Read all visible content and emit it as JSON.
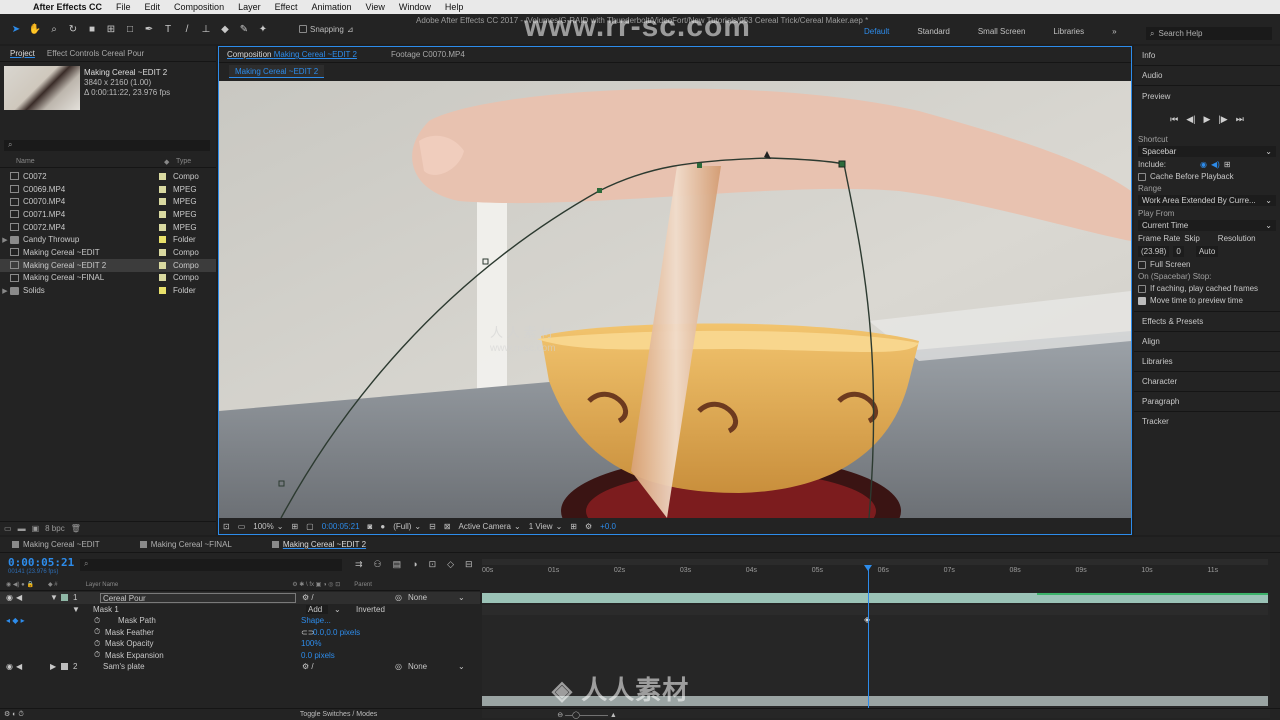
{
  "menubar": {
    "app": "After Effects CC",
    "items": [
      "File",
      "Edit",
      "Composition",
      "Layer",
      "Effect",
      "Animation",
      "View",
      "Window",
      "Help"
    ]
  },
  "toolbar": {
    "window_title": "Adobe After Effects CC 2017 - /Volumes/G-RAID with Thunderbolt/VideoFort/New Tutorials/053 Cereal Trick/Cereal Maker.aep *",
    "snapping_label": "Snapping",
    "workspaces": [
      "Default",
      "Standard",
      "Small Screen",
      "Libraries"
    ],
    "search_placeholder": "Search Help"
  },
  "watermark": {
    "url": "www.rr-sc.com",
    "small": "人 人 素 材",
    "small_url": "www.rr-sc.com",
    "logo": "人人素材"
  },
  "project": {
    "tab_project": "Project",
    "tab_effects": "Effect Controls Cereal Pour",
    "selected_name": "Making Cereal ~EDIT 2",
    "selected_dims": "3840 x 2160 (1.00)",
    "selected_duration": "Δ 0:00:11:22, 23.976 fps",
    "col_name": "Name",
    "col_type": "Type",
    "items": [
      {
        "name": "C0072",
        "type": "Compo",
        "kind": "comp",
        "label": "#d9d9a0"
      },
      {
        "name": "C0069.MP4",
        "type": "MPEG",
        "kind": "file",
        "label": "#d9d9a0"
      },
      {
        "name": "C0070.MP4",
        "type": "MPEG",
        "kind": "file",
        "label": "#d9d9a0"
      },
      {
        "name": "C0071.MP4",
        "type": "MPEG",
        "kind": "file",
        "label": "#d9d9a0"
      },
      {
        "name": "C0072.MP4",
        "type": "MPEG",
        "kind": "file",
        "label": "#d9d9a0"
      },
      {
        "name": "Candy Throwup",
        "type": "Folder",
        "kind": "folder",
        "label": "#e8e06a"
      },
      {
        "name": "Making Cereal ~EDIT",
        "type": "Compo",
        "kind": "comp",
        "label": "#d9d9a0"
      },
      {
        "name": "Making Cereal ~EDIT 2",
        "type": "Compo",
        "kind": "comp",
        "label": "#d9d9a0"
      },
      {
        "name": "Making Cereal ~FINAL",
        "type": "Compo",
        "kind": "comp",
        "label": "#d9d9a0"
      },
      {
        "name": "Solids",
        "type": "Folder",
        "kind": "folder",
        "label": "#e8e06a"
      }
    ],
    "bpc": "8 bpc"
  },
  "composition": {
    "tab_prefix": "Composition",
    "tab_name": "Making Cereal ~EDIT 2",
    "tab_footage": "Footage C0070.MP4",
    "breadcrumb": "Making Cereal ~EDIT 2",
    "zoom": "100%",
    "time": "0:00:05:21",
    "resolution": "(Full)",
    "camera": "Active Camera",
    "views": "1 View",
    "exposure": "+0.0"
  },
  "right_panels": {
    "info": "Info",
    "audio": "Audio",
    "preview": "Preview",
    "shortcut_label": "Shortcut",
    "shortcut_value": "Spacebar",
    "include_label": "Include:",
    "cache_before": "Cache Before Playback",
    "range_label": "Range",
    "range_value": "Work Area Extended By Curre...",
    "play_from_label": "Play From",
    "play_from_value": "Current Time",
    "frame_rate_label": "Frame Rate",
    "skip_label": "Skip",
    "resolution_label": "Resolution",
    "frame_rate_value": "(23.98)",
    "skip_value": "0",
    "resolution_value": "Auto",
    "full_screen": "Full Screen",
    "stop_label": "On (Spacebar) Stop:",
    "if_caching": "If caching, play cached frames",
    "move_time": "Move time to preview time",
    "panels": [
      "Effects & Presets",
      "Align",
      "Libraries",
      "Character",
      "Paragraph",
      "Tracker"
    ]
  },
  "timeline": {
    "tabs": [
      "Making Cereal ~EDIT",
      "Making Cereal ~FINAL",
      "Making Cereal ~EDIT 2"
    ],
    "timecode": "0:00:05:21",
    "fps_line": "00141 (23.976 fps)",
    "col_layer_name": "Layer Name",
    "col_parent": "Parent",
    "ticks": [
      "00s",
      "01s",
      "02s",
      "03s",
      "04s",
      "05s",
      "06s",
      "07s",
      "08s",
      "09s",
      "10s",
      "11s"
    ],
    "layer1": {
      "num": "1",
      "name": "Cereal Pour",
      "parent": "None"
    },
    "mask": {
      "name": "Mask 1",
      "mode": "Add",
      "inverted": "Inverted"
    },
    "mask_path": {
      "label": "Mask Path",
      "value": "Shape..."
    },
    "mask_feather": {
      "label": "Mask Feather",
      "value": "0.0,0.0 pixels"
    },
    "mask_opacity": {
      "label": "Mask Opacity",
      "value": "100%"
    },
    "mask_expansion": {
      "label": "Mask Expansion",
      "value": "0.0 pixels"
    },
    "layer2": {
      "num": "2",
      "name": "Sam's plate",
      "parent": "None"
    },
    "toggle": "Toggle Switches / Modes",
    "playhead_seconds": 5.88,
    "duration_seconds": 11.92
  }
}
